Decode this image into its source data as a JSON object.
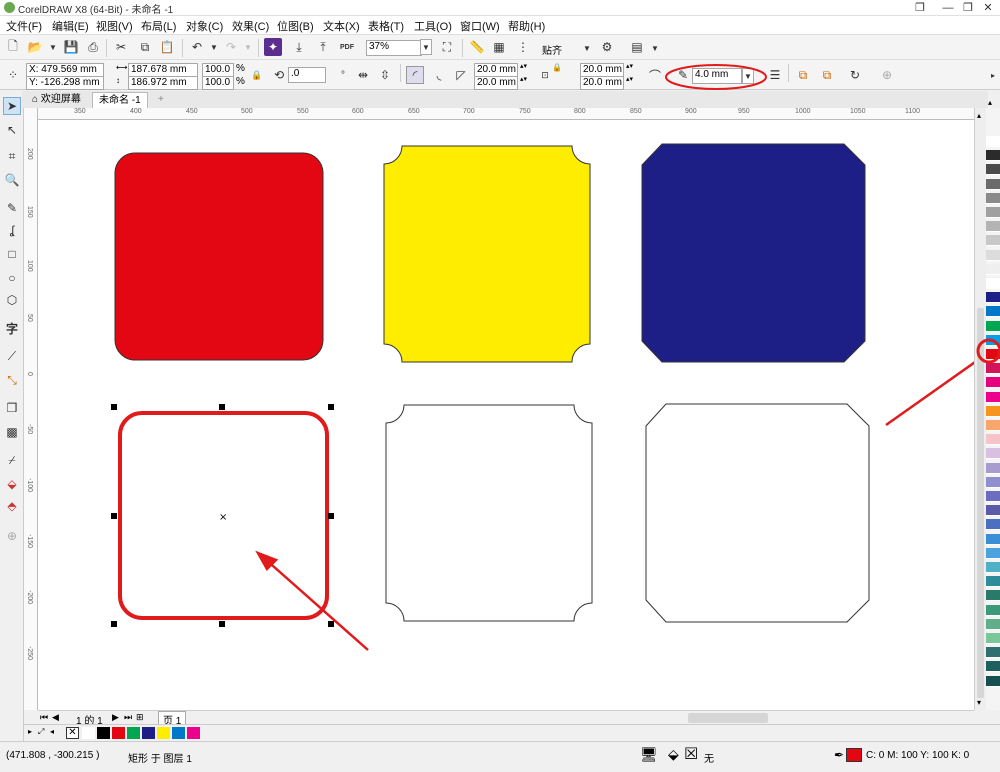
{
  "window": {
    "title": "CorelDRAW X8 (64-Bit) - 未命名 -1"
  },
  "menu": [
    "文件(F)",
    "编辑(E)",
    "视图(V)",
    "布局(L)",
    "对象(C)",
    "效果(C)",
    "位图(B)",
    "文本(X)",
    "表格(T)",
    "工具(O)",
    "窗口(W)",
    "帮助(H)"
  ],
  "toolbar1": {
    "zoom": "37%",
    "pdf_label": "PDF",
    "snap_label": "贴齐"
  },
  "props": {
    "x": "X: 479.569 mm",
    "y": "Y: -126.298 mm",
    "width": "187.678 mm",
    "height": "186.972 mm",
    "scale_w": "100.0",
    "scale_h": "100.0",
    "pct": "%",
    "rotation": ".0",
    "corner_tl": "20.0 mm",
    "corner_bl": "20.0 mm",
    "corner_tr": "20.0 mm",
    "corner_br": "20.0 mm",
    "outline_width": "4.0 mm"
  },
  "tabs": {
    "welcome": "欢迎屏幕",
    "document": "未命名 -1"
  },
  "ruler": {
    "top": [
      "350",
      "400",
      "450",
      "500",
      "550",
      "600",
      "650",
      "700",
      "750",
      "800",
      "850",
      "900",
      "950",
      "1000",
      "1050",
      "1100"
    ],
    "left": [
      "200",
      "150",
      "100",
      "50",
      "0",
      "-50",
      "-100",
      "-150",
      "-200",
      "-250"
    ]
  },
  "pagebar": {
    "page_count": "1 的 1",
    "page_tab": "页 1"
  },
  "status": {
    "coords": "(471.808 , -300.215 )",
    "selection": "矩形 于 图层 1",
    "fill_none": "无",
    "outline_color": "C: 0 M: 100 Y: 100 K: 0"
  },
  "colors": {
    "red": "#e30613",
    "yellow": "#ffed00",
    "navy": "#1d1f86",
    "annotation": "#e01b1b"
  },
  "palette": [
    "#ffffff",
    "#2b2b2b",
    "#4a4a4a",
    "#6a6a6a",
    "#8a8a8a",
    "#a0a0a0",
    "#b4b4b4",
    "#c8c8c8",
    "#dcdcdc",
    "#efefef",
    "#ffffff",
    "#1d1f86",
    "#0077c8",
    "#00a651",
    "#00a0e9",
    "#e30613",
    "#d4145a",
    "#e6007e",
    "#ec008c",
    "#f7941d",
    "#f9a66c",
    "#f5c3c8",
    "#d9bfe0",
    "#a89bd0",
    "#8f8fd0",
    "#6c6cc0",
    "#5a5aa8",
    "#4b70c0",
    "#3a8ed6",
    "#4aa3df",
    "#4fb0c6",
    "#2e8b9a",
    "#2a7a6a",
    "#3a9a7a",
    "#5fb08a",
    "#7ac89a",
    "#2f6f6f",
    "#1f5f5f",
    "#164f4f"
  ],
  "doc_palette": [
    "#ffffff",
    "#000000",
    "#e30613",
    "#00a651",
    "#1d1f86",
    "#ffed00",
    "#0077c8",
    "#ec008c"
  ]
}
